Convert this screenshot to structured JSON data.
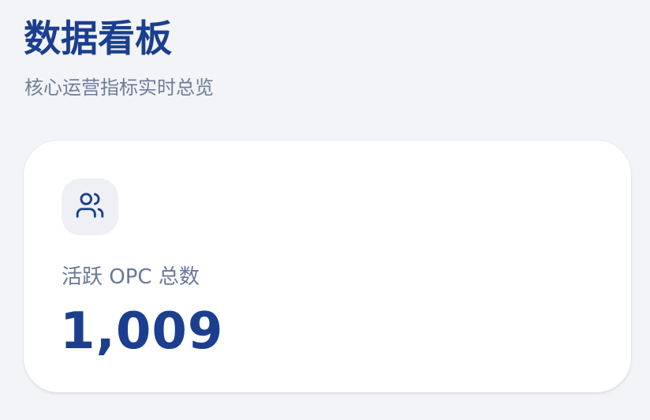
{
  "header": {
    "title": "数据看板",
    "subtitle": "核心运营指标实时总览"
  },
  "metric_card": {
    "icon": "users-icon",
    "label": "活跃 OPC 总数",
    "value": "1,009"
  },
  "colors": {
    "background": "#f3f4f8",
    "primary": "#1b3f8e",
    "muted_text": "#6e7d98",
    "card": "#ffffff",
    "icon_tile": "#eef0f5"
  }
}
